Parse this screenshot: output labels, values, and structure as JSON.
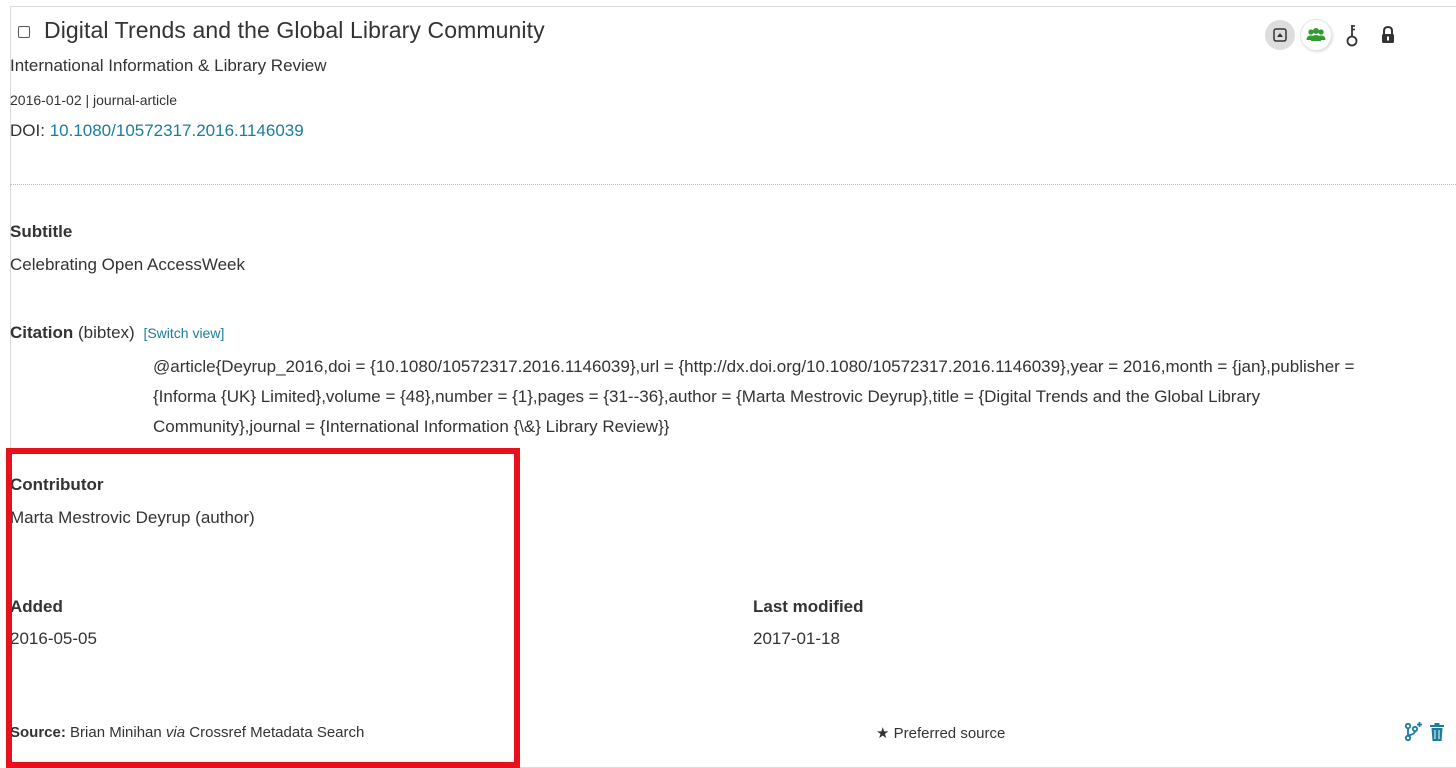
{
  "work": {
    "title": "Digital Trends and the Global Library Community",
    "journal": "International Information & Library Review",
    "meta": "2016-01-02 | journal-article",
    "doi_label": "DOI:",
    "doi_value": "10.1080/10572317.2016.1146039"
  },
  "toolbar": {
    "icons": [
      "caret-up-icon",
      "group-icon",
      "key-icon",
      "lock-icon"
    ],
    "group_icon_color": "#2e9c2e"
  },
  "details": {
    "subtitle_label": "Subtitle",
    "subtitle_value": "Celebrating Open AccessWeek",
    "citation_label": "Citation",
    "citation_format": "(bibtex)",
    "switch_view": "[Switch view]",
    "citation_text": "@article{Deyrup_2016,doi = {10.1080/10572317.2016.1146039},url = {http://dx.doi.org/10.1080/10572317.2016.1146039},year = 2016,month = {jan},publisher = {Informa {UK} Limited},volume = {48},number = {1},pages = {31--36},author = {Marta Mestrovic Deyrup},title = {Digital Trends and the Global Library Community},journal = {International Information {\\&} Library Review}}",
    "contributor_label": "Contributor",
    "contributor_value": "Marta Mestrovic Deyrup (author)",
    "added_label": "Added",
    "added_value": "2016-05-05",
    "modified_label": "Last modified",
    "modified_value": "2017-01-18"
  },
  "source": {
    "label": "Source:",
    "name": "Brian Minihan",
    "via": "via",
    "system": "Crossref Metadata Search",
    "preferred_star": "★",
    "preferred_text": "Preferred source",
    "action_icons": [
      "fork-plus-icon",
      "trash-icon"
    ]
  },
  "colors": {
    "link": "#1b7c9c",
    "highlight": "#e8111b",
    "pill_gray": "#dddddd"
  }
}
